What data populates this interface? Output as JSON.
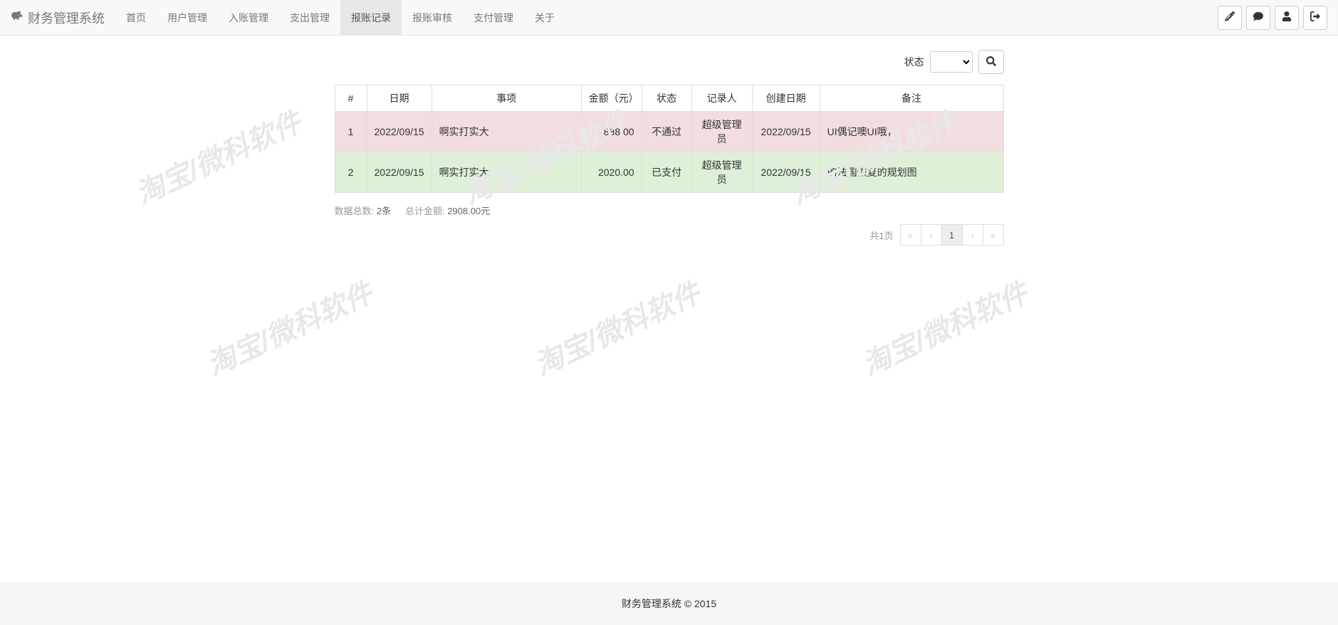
{
  "brand": "财务管理系统",
  "nav": {
    "items": [
      {
        "label": "首页"
      },
      {
        "label": "用户管理"
      },
      {
        "label": "入账管理"
      },
      {
        "label": "支出管理"
      },
      {
        "label": "报账记录",
        "active": true
      },
      {
        "label": "报账审核"
      },
      {
        "label": "支付管理"
      },
      {
        "label": "关于"
      }
    ]
  },
  "filter": {
    "label": "状态",
    "selected": ""
  },
  "table": {
    "headers": [
      "#",
      "日期",
      "事项",
      "金额（元）",
      "状态",
      "记录人",
      "创建日期",
      "备注"
    ],
    "rows": [
      {
        "idx": "1",
        "date": "2022/09/15",
        "item": "啊实打实大",
        "amount": "888.00",
        "status": "不通过",
        "recorder": "超级管理员",
        "created": "2022/09/15",
        "remark": "UI偶记噢UI哦，",
        "rowClass": "row-red"
      },
      {
        "idx": "2",
        "date": "2022/09/15",
        "item": "啊实打实大",
        "amount": "2020.00",
        "status": "已支付",
        "recorder": "超级管理员",
        "created": "2022/09/15",
        "remark": "的法国恢复的规划图",
        "rowClass": "row-green"
      }
    ]
  },
  "summary": {
    "count_label": "数据总数:",
    "count_value": "2条",
    "amount_label": "总计金额:",
    "amount_value": "2908.00元"
  },
  "pagination": {
    "info": "共1页",
    "current": "1"
  },
  "footer": "财务管理系统 © 2015",
  "watermark_text": "淘宝/微科软件"
}
